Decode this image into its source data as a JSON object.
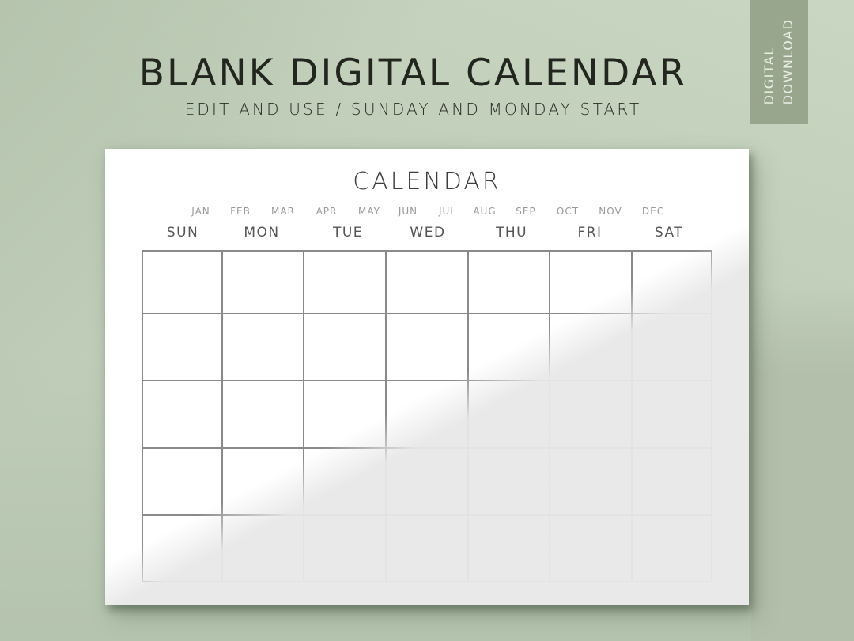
{
  "header": {
    "title": "BLANK DIGITAL CALENDAR",
    "subtitle": "EDIT AND USE / SUNDAY AND MONDAY START"
  },
  "badge": {
    "line1": "DIGITAL",
    "line2": "DOWNLOAD"
  },
  "calendar": {
    "title": "CALENDAR",
    "months": [
      "JAN",
      "FEB",
      "MAR",
      "APR",
      "MAY",
      "JUN",
      "JUL",
      "AUG",
      "SEP",
      "OCT",
      "NOV",
      "DEC"
    ],
    "weekdays": [
      "SUN",
      "MON",
      "TUE",
      "WED",
      "THU",
      "FRI",
      "SAT"
    ],
    "rows": 5,
    "columns": 7
  },
  "colors": {
    "background": "#bfcdb9",
    "badge": "#97a68d",
    "title_text": "#23261f",
    "grid_line": "#8a8a8a"
  }
}
